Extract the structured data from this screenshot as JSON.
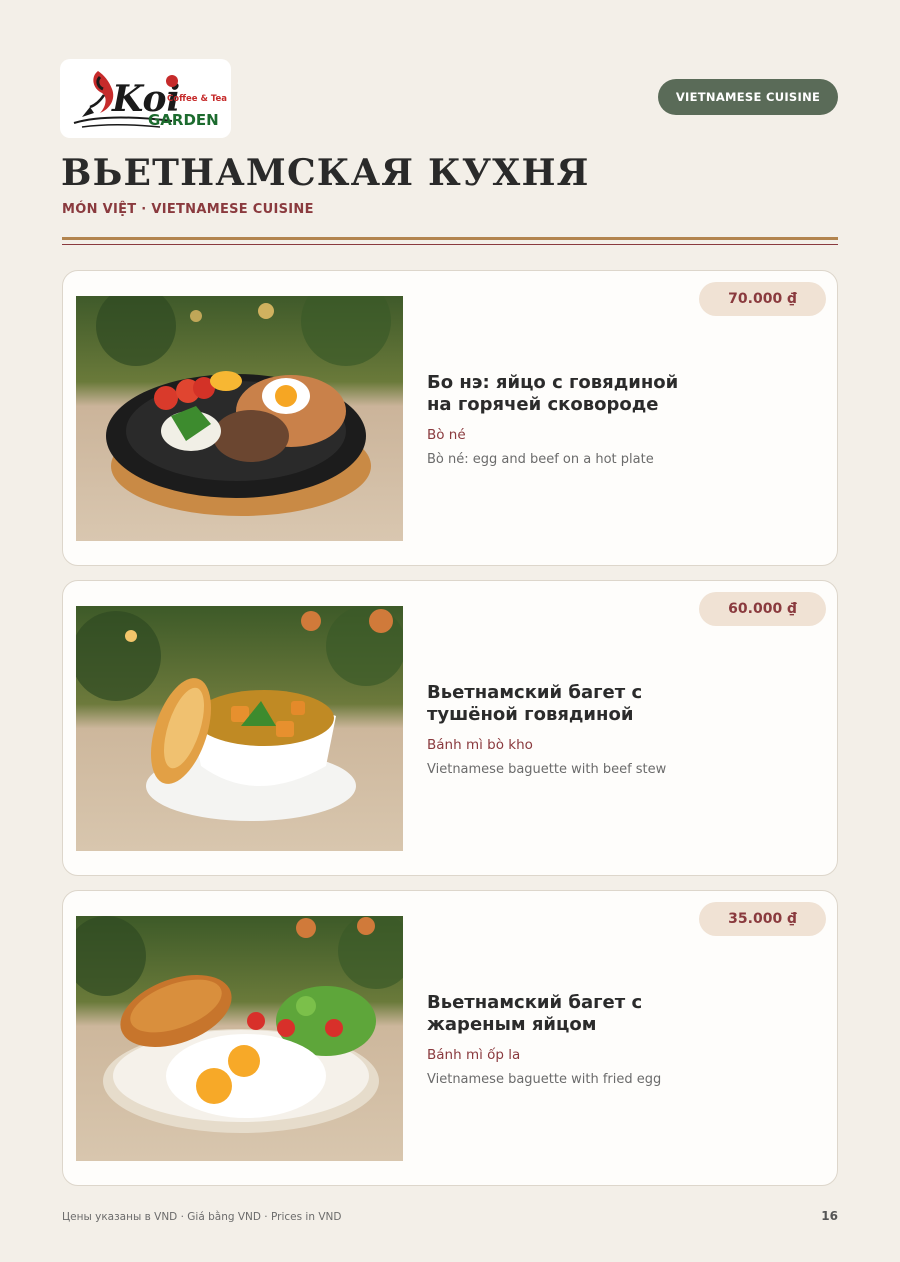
{
  "brand": {
    "logo_text": "Koi",
    "logo_tagline": "Coffee & Tea",
    "logo_name": "GARDEN"
  },
  "header": {
    "badge": "VIETNAMESE CUISINE",
    "title": "ВЬЕТНАМСКАЯ КУХНЯ",
    "subtitle": "MÓN VIỆT · VIETNAMESE CUISINE"
  },
  "colors": {
    "accent": "#8a3a3e",
    "badge_bg": "#5a6b58",
    "rule": "#b2844e",
    "price_bg": "#f0e2d4",
    "page_bg": "#f3efe8"
  },
  "items": [
    {
      "price": "70.000 ₫",
      "name": "Бо нэ: яйцо с говядиной на горячей сковороде",
      "viet": "Bò né",
      "desc": "Bò né: egg and beef on a hot plate",
      "image": "bo-ne-photo"
    },
    {
      "price": "60.000 ₫",
      "name": "Вьетнамский багет с тушёной говядиной",
      "viet": "Bánh mì bò kho",
      "desc": "Vietnamese baguette with beef stew",
      "image": "banh-mi-bo-kho-photo"
    },
    {
      "price": "35.000 ₫",
      "name": "Вьетнамский багет с жареным яйцом",
      "viet": "Bánh mì ốp la",
      "desc": "Vietnamese baguette with fried egg",
      "image": "banh-mi-op-la-photo"
    }
  ],
  "footer": {
    "note": "Цены указаны в VND · Giá bằng VND · Prices in VND",
    "page": "16"
  }
}
